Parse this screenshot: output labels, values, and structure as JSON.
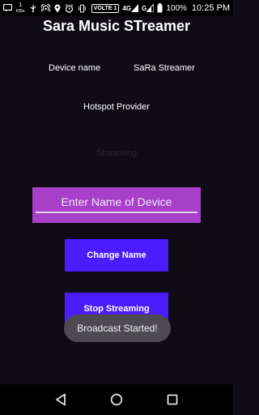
{
  "status_bar": {
    "speed_value": "1",
    "speed_unit": "KB/s",
    "volte": "VOLTE 1",
    "network": "4G",
    "network2": "G",
    "battery": "100%",
    "time": "10:25 PM"
  },
  "app": {
    "title": "Sara Music STreamer",
    "device_label": "Device name",
    "device_value": "SaRa Streamer",
    "hotspot_label": "Hotspot Provider",
    "faint_status": "Streaming"
  },
  "form": {
    "name_placeholder": "Enter Name of Device",
    "change_button": "Change Name",
    "stop_button": "Stop Streaming"
  },
  "toast": {
    "message": "Broadcast Started!"
  },
  "colors": {
    "background": "#100c16",
    "input_panel": "#a83fc9",
    "button": "#4a1cff",
    "toast": "#4d4a52"
  },
  "icons": {
    "status_left": [
      "notification-icon",
      "data-speed-icon",
      "usb-icon",
      "hotspot-icon",
      "location-icon",
      "alarm-icon",
      "vibrate-icon"
    ],
    "status_right": [
      "volte-icon",
      "signal-4g-icon",
      "signal-g-icon",
      "battery-icon"
    ],
    "nav": [
      "back-icon",
      "home-icon",
      "recents-icon"
    ]
  }
}
